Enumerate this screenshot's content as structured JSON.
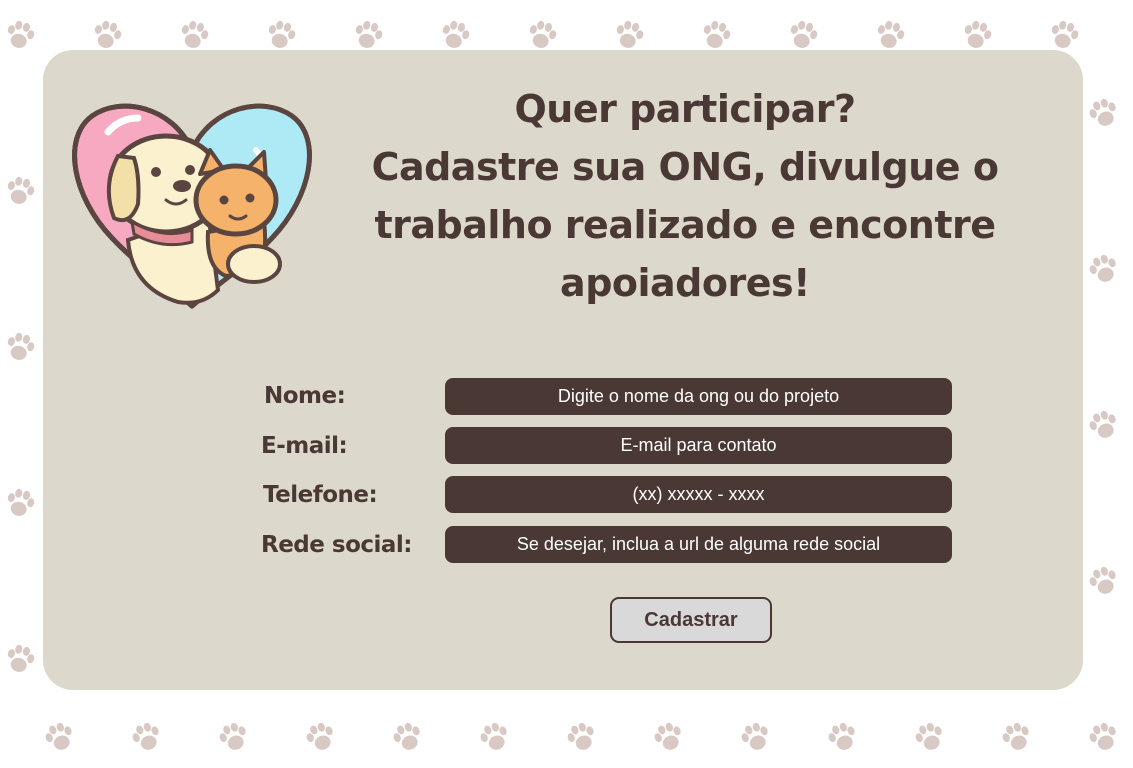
{
  "headline": {
    "line1": "Quer participar?",
    "line2": "Cadastre sua ONG, divulgue o",
    "line3": "trabalho realizado e encontre",
    "line4": "apoiadores!"
  },
  "form": {
    "name_label": "Nome:",
    "name_placeholder": "Digite o nome da ong ou do projeto",
    "email_label": "E-mail:",
    "email_placeholder": "E-mail para contato",
    "phone_label": "Telefone:",
    "phone_placeholder": "(xx) xxxxx - xxxx",
    "social_label": "Rede social:",
    "social_placeholder": "Se desejar, inclua a url de alguma rede social",
    "submit_label": "Cadastrar"
  },
  "icons": {
    "logo": "dog-and-cat-heart-icon",
    "background_pattern": "paw-print-icon"
  },
  "colors": {
    "text_dark": "#4a3835",
    "card_bg": "#ddd8cc",
    "input_bg": "#4a3835",
    "button_bg": "#d9d9d9",
    "paw": "#d8c9c5"
  }
}
